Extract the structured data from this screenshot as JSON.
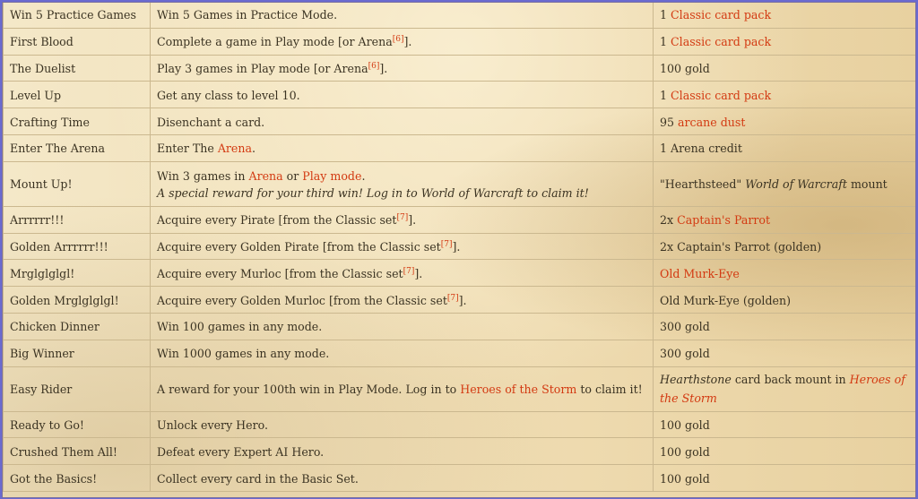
{
  "rows": [
    {
      "name": "Win 5 Practice Games",
      "desc": [
        {
          "t": "Win 5 Games in Practice Mode."
        }
      ],
      "reward": [
        {
          "t": "1 "
        },
        {
          "t": "Classic card pack",
          "c": "red"
        }
      ]
    },
    {
      "name": "First Blood",
      "desc": [
        {
          "t": "Complete a game in Play mode [or Arena"
        },
        {
          "t": "[6]",
          "c": "sup"
        },
        {
          "t": "]."
        }
      ],
      "reward": [
        {
          "t": "1 "
        },
        {
          "t": "Classic card pack",
          "c": "red"
        }
      ]
    },
    {
      "name": "The Duelist",
      "desc": [
        {
          "t": "Play 3 games in Play mode [or Arena"
        },
        {
          "t": "[6]",
          "c": "sup"
        },
        {
          "t": "]."
        }
      ],
      "reward": [
        {
          "t": "100 gold"
        }
      ]
    },
    {
      "name": "Level Up",
      "desc": [
        {
          "t": "Get any class to level 10."
        }
      ],
      "reward": [
        {
          "t": "1 "
        },
        {
          "t": "Classic card pack",
          "c": "red"
        }
      ]
    },
    {
      "name": "Crafting Time",
      "desc": [
        {
          "t": "Disenchant a card."
        }
      ],
      "reward": [
        {
          "t": "95 "
        },
        {
          "t": "arcane dust",
          "c": "red"
        }
      ]
    },
    {
      "name": "Enter The Arena",
      "desc": [
        {
          "t": "Enter The "
        },
        {
          "t": "Arena",
          "c": "red"
        },
        {
          "t": "."
        }
      ],
      "reward": [
        {
          "t": "1 Arena credit"
        }
      ]
    },
    {
      "name": "Mount Up!",
      "tall": true,
      "desc": [
        {
          "t": "Win 3 games in "
        },
        {
          "t": "Arena",
          "c": "red"
        },
        {
          "t": " or "
        },
        {
          "t": "Play mode",
          "c": "red"
        },
        {
          "t": ".",
          "br": true
        },
        {
          "t": "A special reward for your third win! Log in to World of Warcraft to claim it!",
          "c": "i"
        }
      ],
      "reward": [
        {
          "t": "\"Hearthsteed\" "
        },
        {
          "t": "World of Warcraft",
          "c": "i"
        },
        {
          "t": " mount"
        }
      ]
    },
    {
      "name": "Arrrrrr!!!",
      "desc": [
        {
          "t": "Acquire every Pirate [from the Classic set"
        },
        {
          "t": "[7]",
          "c": "sup"
        },
        {
          "t": "]."
        }
      ],
      "reward": [
        {
          "t": "2x "
        },
        {
          "t": "Captain's Parrot",
          "c": "red"
        }
      ]
    },
    {
      "name": "Golden Arrrrrr!!!",
      "desc": [
        {
          "t": "Acquire every Golden Pirate [from the Classic set"
        },
        {
          "t": "[7]",
          "c": "sup"
        },
        {
          "t": "]."
        }
      ],
      "reward": [
        {
          "t": "2x Captain's Parrot (golden)"
        }
      ]
    },
    {
      "name": "Mrglglglgl!",
      "desc": [
        {
          "t": "Acquire every Murloc [from the Classic set"
        },
        {
          "t": "[7]",
          "c": "sup"
        },
        {
          "t": "]."
        }
      ],
      "reward": [
        {
          "t": "Old Murk-Eye",
          "c": "red"
        }
      ]
    },
    {
      "name": "Golden Mrglglglgl!",
      "desc": [
        {
          "t": "Acquire every Golden Murloc [from the Classic set"
        },
        {
          "t": "[7]",
          "c": "sup"
        },
        {
          "t": "]."
        }
      ],
      "reward": [
        {
          "t": "Old Murk-Eye (golden)"
        }
      ]
    },
    {
      "name": "Chicken Dinner",
      "desc": [
        {
          "t": "Win 100 games in any mode."
        }
      ],
      "reward": [
        {
          "t": "300 gold"
        }
      ]
    },
    {
      "name": "Big Winner",
      "desc": [
        {
          "t": "Win 1000 games in any mode."
        }
      ],
      "reward": [
        {
          "t": "300 gold"
        }
      ]
    },
    {
      "name": "Easy Rider",
      "tall": true,
      "desc": [
        {
          "t": "A reward for your 100th win in Play Mode. Log in to "
        },
        {
          "t": "Heroes of the Storm",
          "c": "red"
        },
        {
          "t": " to claim it!"
        }
      ],
      "reward": [
        {
          "t": "Hearthstone",
          "c": "i"
        },
        {
          "t": " card back mount in "
        },
        {
          "t": "Heroes of the Storm",
          "c": "red i"
        }
      ]
    },
    {
      "name": "Ready to Go!",
      "desc": [
        {
          "t": "Unlock every Hero."
        }
      ],
      "reward": [
        {
          "t": "100 gold"
        }
      ]
    },
    {
      "name": "Crushed Them All!",
      "desc": [
        {
          "t": "Defeat every Expert AI Hero."
        }
      ],
      "reward": [
        {
          "t": "100 gold"
        }
      ]
    },
    {
      "name": "Got the Basics!",
      "desc": [
        {
          "t": "Collect every card in the Basic Set."
        }
      ],
      "reward": [
        {
          "t": "100 gold"
        }
      ]
    }
  ]
}
